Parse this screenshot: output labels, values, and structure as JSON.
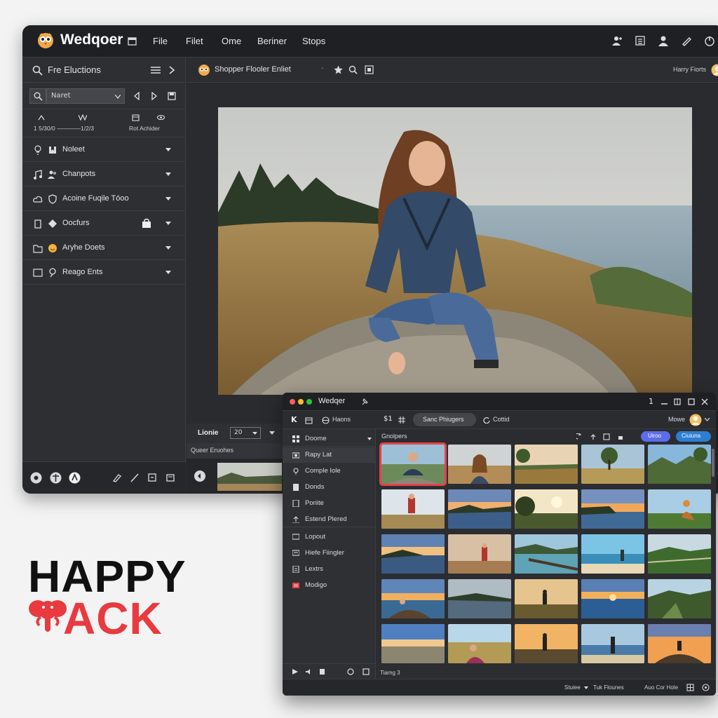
{
  "app": {
    "name": "Wedqoer"
  },
  "menu": {
    "items": [
      "File",
      "Filet",
      "Ome",
      "Beriner",
      "Stops"
    ]
  },
  "sidebar": {
    "header_title": "Fre Eluctions",
    "search_value": "Naret",
    "stat_left": "1 5/30/0 ————1/2/3",
    "stat_right": "Rot Achider",
    "items": [
      {
        "label": "Noleet"
      },
      {
        "label": "Chanpots"
      },
      {
        "label": "Acoine Fuqile Tóoo"
      },
      {
        "label": "Oocfurs"
      },
      {
        "label": "Aryhe Doets"
      },
      {
        "label": "Reago Ents"
      }
    ]
  },
  "center": {
    "breadcrumb": "Shopper Flooler Enliet",
    "user_name": "Harry Fiorts",
    "strip_label": "Lionie",
    "strip_value": "20",
    "strip_tab": "Queer Eruohes"
  },
  "front_window": {
    "title": "Wedqer",
    "toolbar_left": "Haons",
    "toolbar_pill": "Sanc Phiugers",
    "toolbar_right": "Cottid",
    "user_label": "Mowe",
    "grid_head": "Gnolpers",
    "btn_primary": "Uiroo",
    "btn_secondary": "Ciuiuna",
    "sidebar_items": [
      "Doome",
      "Rapy Lat",
      "Comple Iole",
      "Donds",
      "Poriite",
      "Estend Plered",
      "Lopout",
      "Hiefe Fiingler",
      "Lextrs",
      "Modigo"
    ],
    "status_left": "Tiamg 3",
    "status_a": "Stuiee",
    "status_b": "Tuk Flounes",
    "status_c": "Auo Cor Hole"
  },
  "brand": {
    "line1": "HAPPY",
    "line2": "ACK"
  },
  "colors": {
    "accent_red": "#e83a3f",
    "button_blue": "#5b6de8",
    "button_teal": "#2d7dd2",
    "selection": "#e4424a"
  }
}
